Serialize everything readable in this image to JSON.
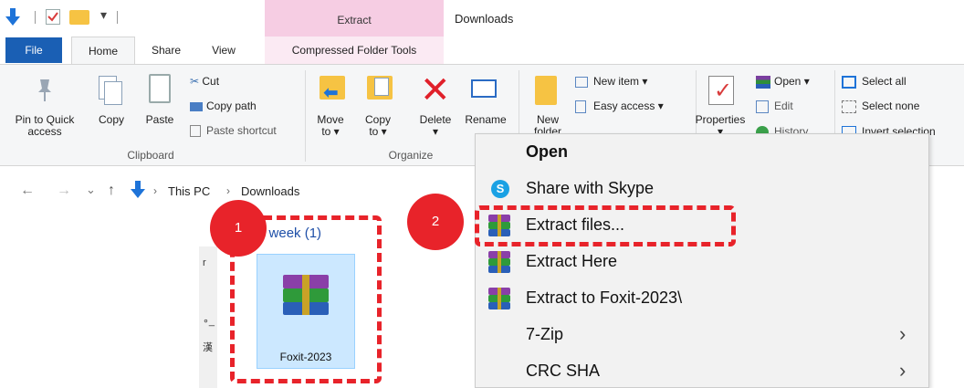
{
  "titlebar": {
    "context_tab": "Extract",
    "window_title": "Downloads"
  },
  "tabs": {
    "file": "File",
    "home": "Home",
    "share": "Share",
    "view": "View",
    "compressed": "Compressed Folder Tools"
  },
  "ribbon": {
    "clipboard": {
      "group_label": "Clipboard",
      "pin_line1": "Pin to Quick",
      "pin_line2": "access",
      "copy": "Copy",
      "paste": "Paste",
      "cut": "Cut",
      "copy_path": "Copy path",
      "paste_shortcut": "Paste shortcut"
    },
    "organize": {
      "group_label": "Organize",
      "move_line1": "Move",
      "move_line2": "to ▾",
      "copy_line1": "Copy",
      "copy_line2": "to ▾",
      "delete": "Delete",
      "delete_arrow": "▾",
      "rename": "Rename"
    },
    "new": {
      "new_line1": "New",
      "new_line2": "folder",
      "new_item": "New item ▾",
      "easy_access": "Easy access ▾"
    },
    "open": {
      "properties": "Properties",
      "properties_arrow": "▾",
      "open": "Open ▾",
      "edit": "Edit",
      "history": "History"
    },
    "select": {
      "select_all": "Select all",
      "select_none": "Select none",
      "invert": "Invert selection"
    }
  },
  "navbar": {
    "back": "←",
    "forward": "→",
    "recent": "⌄",
    "up": "↑",
    "crumb_sep": "›",
    "crumb_this_pc": "This PC",
    "crumb_downloads": "Downloads"
  },
  "content": {
    "group_header": "Last week (1)",
    "file_name": "Foxit-2023",
    "strip_glyphs": [
      "r",
      "∘_",
      "漢"
    ]
  },
  "context_menu": {
    "items": [
      {
        "label": "Open",
        "bold": true
      },
      {
        "label": "Share with Skype"
      },
      {
        "label": "Extract files..."
      },
      {
        "label": "Extract Here"
      },
      {
        "label": "Extract to Foxit-2023\\"
      },
      {
        "label": "7-Zip",
        "submenu": true
      },
      {
        "label": "CRC SHA",
        "submenu": true
      }
    ],
    "chevron": "›",
    "skype_letter": "S"
  },
  "annotations": {
    "badge_1": "1",
    "badge_2": "2"
  },
  "colors": {
    "annotation_red": "#e8232a",
    "file_tab_blue": "#1a5fb4",
    "context_tab_pink": "#f6cde3",
    "selection_blue": "#cce8ff"
  }
}
